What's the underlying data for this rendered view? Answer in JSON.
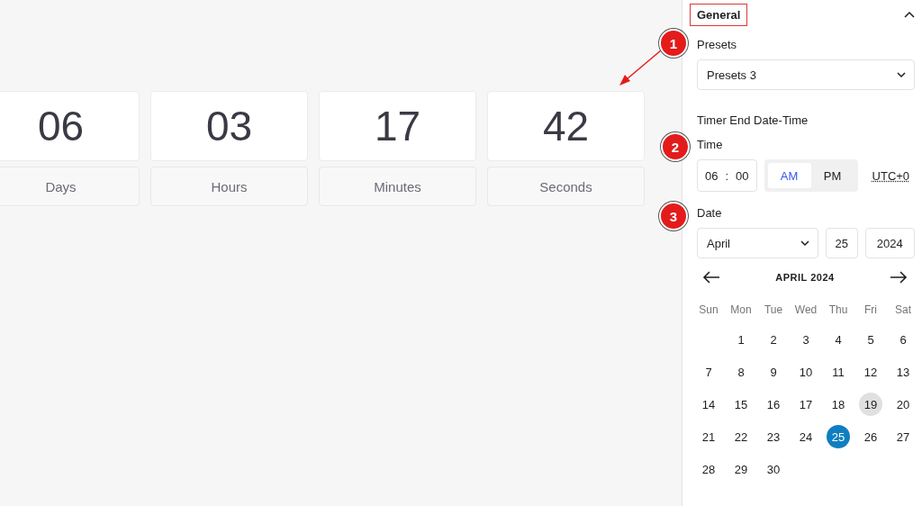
{
  "countdown": [
    {
      "value": "06",
      "label": "Days"
    },
    {
      "value": "03",
      "label": "Hours"
    },
    {
      "value": "17",
      "label": "Minutes"
    },
    {
      "value": "42",
      "label": "Seconds"
    }
  ],
  "panel": {
    "title": "General",
    "expanded": true,
    "presets": {
      "label": "Presets",
      "value": "Presets 3"
    },
    "section_title": "Timer End Date-Time",
    "time": {
      "label": "Time",
      "hour": "06",
      "separator": ":",
      "minute": "00",
      "periods": [
        {
          "label": "AM",
          "selected": true
        },
        {
          "label": "PM",
          "selected": false
        }
      ],
      "timezone": "UTC+0"
    },
    "date": {
      "label": "Date",
      "month": "April",
      "day": "25",
      "year": "2024"
    },
    "calendar": {
      "title": "APRIL 2024",
      "weekdays": [
        "Sun",
        "Mon",
        "Tue",
        "Wed",
        "Thu",
        "Fri",
        "Sat"
      ],
      "weeks": [
        [
          {
            "label": "1",
            "selected": false,
            "today": false
          },
          {
            "label": "2",
            "selected": false,
            "today": false
          },
          {
            "label": "3",
            "selected": false,
            "today": false
          },
          {
            "label": "4",
            "selected": false,
            "today": false
          },
          {
            "label": "5",
            "selected": false,
            "today": false
          },
          {
            "label": "6",
            "selected": false,
            "today": false
          }
        ],
        [
          {
            "label": "7",
            "selected": false,
            "today": false
          },
          {
            "label": "8",
            "selected": false,
            "today": false
          },
          {
            "label": "9",
            "selected": false,
            "today": false
          },
          {
            "label": "10",
            "selected": false,
            "today": false
          },
          {
            "label": "11",
            "selected": false,
            "today": false
          },
          {
            "label": "12",
            "selected": false,
            "today": false
          },
          {
            "label": "13",
            "selected": false,
            "today": false
          }
        ],
        [
          {
            "label": "14",
            "selected": false,
            "today": false
          },
          {
            "label": "15",
            "selected": false,
            "today": false
          },
          {
            "label": "16",
            "selected": false,
            "today": false
          },
          {
            "label": "17",
            "selected": false,
            "today": false
          },
          {
            "label": "18",
            "selected": false,
            "today": false
          },
          {
            "label": "19",
            "selected": false,
            "today": true
          },
          {
            "label": "20",
            "selected": false,
            "today": false
          }
        ],
        [
          {
            "label": "21",
            "selected": false,
            "today": false
          },
          {
            "label": "22",
            "selected": false,
            "today": false
          },
          {
            "label": "23",
            "selected": false,
            "today": false
          },
          {
            "label": "24",
            "selected": false,
            "today": false
          },
          {
            "label": "25",
            "selected": true,
            "today": false
          },
          {
            "label": "26",
            "selected": false,
            "today": false
          },
          {
            "label": "27",
            "selected": false,
            "today": false
          }
        ],
        [
          {
            "label": "28",
            "selected": false,
            "today": false
          },
          {
            "label": "29",
            "selected": false,
            "today": false
          },
          {
            "label": "30",
            "selected": false,
            "today": false
          }
        ]
      ]
    }
  },
  "annotations": [
    {
      "label": "1"
    },
    {
      "label": "2"
    },
    {
      "label": "3"
    }
  ]
}
